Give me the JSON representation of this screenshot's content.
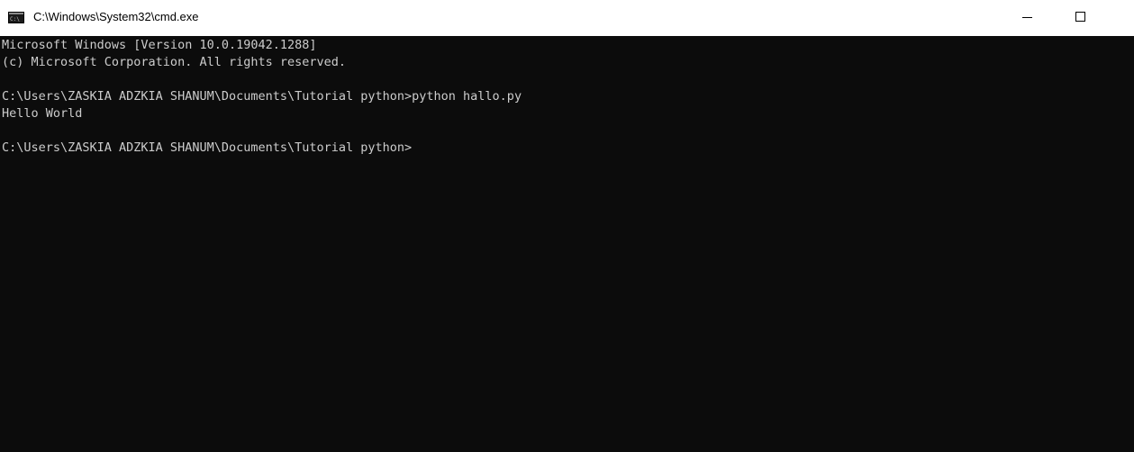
{
  "window": {
    "title": "C:\\Windows\\System32\\cmd.exe",
    "icon": "cmd-icon",
    "controls": [
      "minimize-icon",
      "maximize-icon"
    ]
  },
  "console": {
    "background_color": "#0c0c0c",
    "text_color": "#cccccc",
    "lines": [
      "Microsoft Windows [Version 10.0.19042.1288]",
      "(c) Microsoft Corporation. All rights reserved.",
      "",
      "C:\\Users\\ZASKIA ADZKIA SHANUM\\Documents\\Tutorial python>python hallo.py",
      "Hello World",
      "",
      "C:\\Users\\ZASKIA ADZKIA SHANUM\\Documents\\Tutorial python>"
    ]
  }
}
